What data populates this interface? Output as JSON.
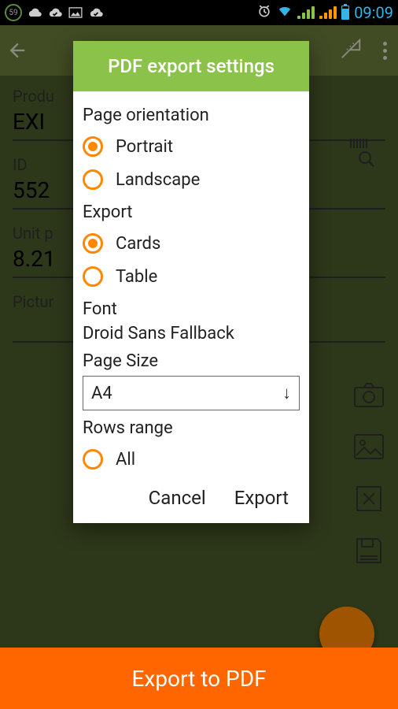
{
  "status": {
    "badge": "59",
    "time": "09:09"
  },
  "background": {
    "productLabel": "Produ",
    "productValue": "EXI",
    "idLabel": "ID",
    "idValue": "552",
    "unitLabel": "Unit p",
    "unitValue": "8.21",
    "pictureLabel": "Pictur"
  },
  "dialog": {
    "title": "PDF export settings",
    "orientation": {
      "label": "Page orientation",
      "options": [
        "Portrait",
        "Landscape"
      ],
      "selected": "Portrait"
    },
    "export": {
      "label": "Export",
      "options": [
        "Cards",
        "Table"
      ],
      "selected": "Cards"
    },
    "font": {
      "label": "Font",
      "value": "Droid Sans Fallback"
    },
    "pageSize": {
      "label": "Page Size",
      "value": "A4"
    },
    "rows": {
      "label": "Rows range",
      "option": "All",
      "selected": false
    },
    "actions": {
      "cancel": "Cancel",
      "export": "Export"
    }
  },
  "bottomBar": {
    "label": "Export to PDF"
  }
}
